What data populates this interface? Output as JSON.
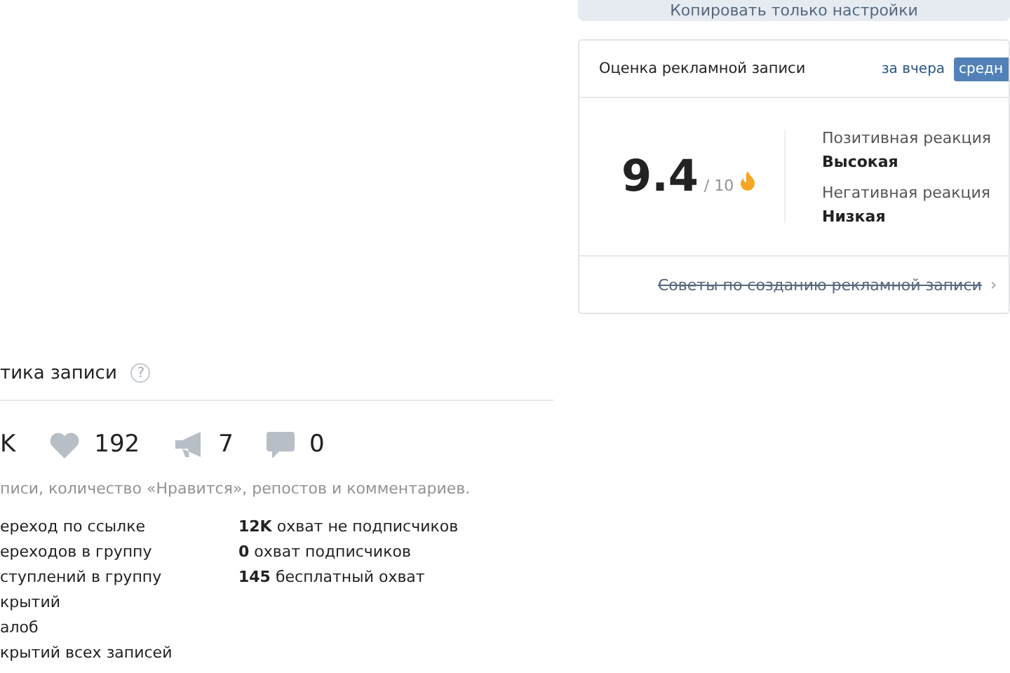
{
  "copy_button": {
    "label": "Копировать только настройки"
  },
  "rating_card": {
    "title": "Оценка рекламной записи",
    "tabs": [
      {
        "label": "за вчера",
        "selected": false
      },
      {
        "label": "средн",
        "selected": true
      }
    ],
    "score": "9.4",
    "score_max": "/ 10",
    "reactions": [
      {
        "label": "Позитивная реакция",
        "value": "Высокая"
      },
      {
        "label": "Негативная реакция",
        "value": "Низкая"
      }
    ],
    "tips_link": "Советы по созданию рекламной записи",
    "tips_chevron": "›"
  },
  "post_stats": {
    "title": "тика записи",
    "help": "?",
    "counters": [
      {
        "kind": "reach",
        "value": "K"
      },
      {
        "kind": "likes",
        "value": "192"
      },
      {
        "kind": "reposts",
        "value": "7"
      },
      {
        "kind": "comments",
        "value": "0"
      }
    ],
    "description": "писи, количество «Нравится», репостов и комментариев.",
    "left_list": [
      "ереход по ссылке",
      "ереходов в группу",
      "ступлений в группу",
      "крытий",
      "алоб",
      "крытий всех записей"
    ],
    "right_list": [
      "**12K** охват не подписчиков",
      "**0** охват подписчиков",
      "**145** бесплатный охват"
    ]
  }
}
